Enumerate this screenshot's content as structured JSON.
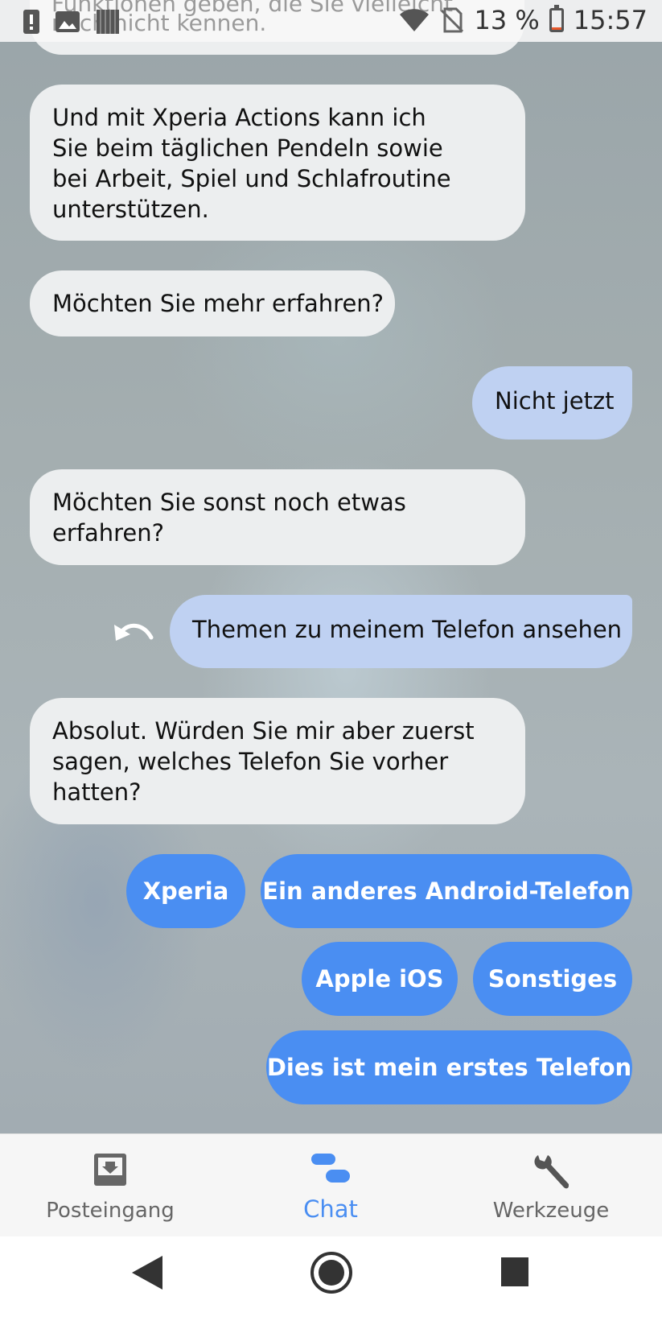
{
  "status_bar": {
    "peek_line1": "Funktionen geben, die Sie vielleicht",
    "peek_line2": "noch nicht kennen.",
    "battery_percent_text": "13 %",
    "battery_level": 0.13,
    "time": "15:57",
    "icons": [
      "alert-icon",
      "image-icon",
      "storage-icon",
      "wifi-icon",
      "no-sim-icon",
      "battery-icon"
    ]
  },
  "messages": [
    {
      "sender": "bot",
      "lines": [
        "Und mit Xperia Actions kann ich",
        "Sie beim täglichen Pendeln sowie",
        "bei Arbeit, Spiel und Schlafroutine",
        "unterstützen."
      ]
    },
    {
      "sender": "bot",
      "lines": [
        "Möchten Sie mehr erfahren?"
      ]
    },
    {
      "sender": "user",
      "lines": [
        "Nicht jetzt"
      ]
    },
    {
      "sender": "bot",
      "lines": [
        "Möchten Sie sonst noch etwas",
        "erfahren?"
      ]
    },
    {
      "sender": "user",
      "lines": [
        "Themen zu meinem Telefon ansehen"
      ]
    },
    {
      "sender": "bot",
      "lines": [
        "Absolut. Würden Sie mir aber zuerst",
        "sagen, welches Telefon Sie vorher",
        "hatten?"
      ]
    }
  ],
  "quick_replies": [
    "Xperia",
    "Ein anderes Android-Telefon",
    "Apple iOS",
    "Sonstiges",
    "Dies ist mein erstes Telefon"
  ],
  "bottom_nav": {
    "items": [
      {
        "label": "Posteingang",
        "icon": "inbox-icon"
      },
      {
        "label": "Chat",
        "icon": "chat-icon",
        "active": true
      },
      {
        "label": "Werkzeuge",
        "icon": "wrench-icon"
      }
    ]
  },
  "colors": {
    "bot_bubble": "#eceeef",
    "user_bubble": "#bfd1f2",
    "chip": "#4a8ef2",
    "nav_active": "#4a8ef2"
  }
}
